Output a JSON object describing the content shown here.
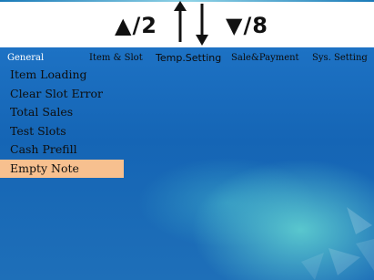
{
  "hints": {
    "up": "▲/2",
    "down": "▼/8"
  },
  "tabs": [
    {
      "label": "General",
      "active": true
    },
    {
      "label": "Item & Slot",
      "active": false
    },
    {
      "label": "Temp.Setting",
      "active": false
    },
    {
      "label": "Sale&Payment",
      "active": false
    },
    {
      "label": "Sys. Setting",
      "active": false
    }
  ],
  "menu": {
    "items": [
      {
        "label": "Item Loading"
      },
      {
        "label": "Clear Slot Error"
      },
      {
        "label": "Total Sales"
      },
      {
        "label": "Test Slots"
      },
      {
        "label": "Cash Prefill"
      },
      {
        "label": "Empty Note",
        "selected": true
      }
    ]
  },
  "colors": {
    "panel": "#1565b5",
    "selection": "#f7c08f",
    "accent_glow": "#64d7d2"
  }
}
